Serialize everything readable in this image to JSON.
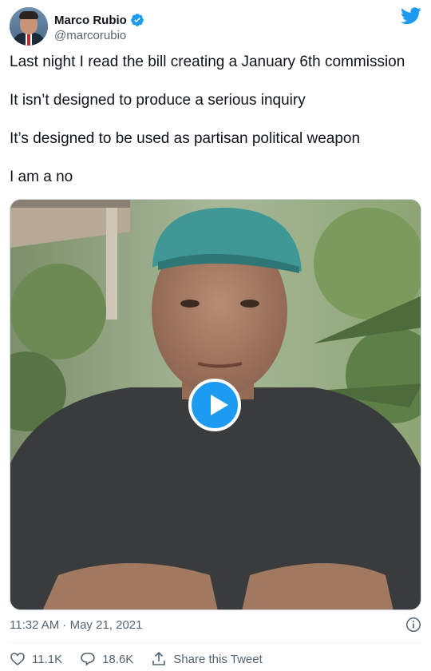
{
  "author": {
    "name": "Marco Rubio",
    "handle": "@marcorubio",
    "verified": true,
    "avatar_icon": "profile-photo"
  },
  "brand": {
    "logo_icon": "twitter-bird-icon",
    "accent_color": "#1d9bf0"
  },
  "tweet": {
    "lines": [
      "Last night I read the bill creating a January 6th commission",
      "It isn’t designed to produce a serious inquiry",
      "It’s designed to be used as partisan political weapon",
      "I am a no"
    ],
    "timestamp": "11:32 AM · May 21, 2021"
  },
  "media": {
    "type": "video",
    "play_icon": "play-icon"
  },
  "actions": {
    "like_count": "11.1K",
    "reply_count": "18.6K",
    "share_label": "Share this Tweet"
  }
}
